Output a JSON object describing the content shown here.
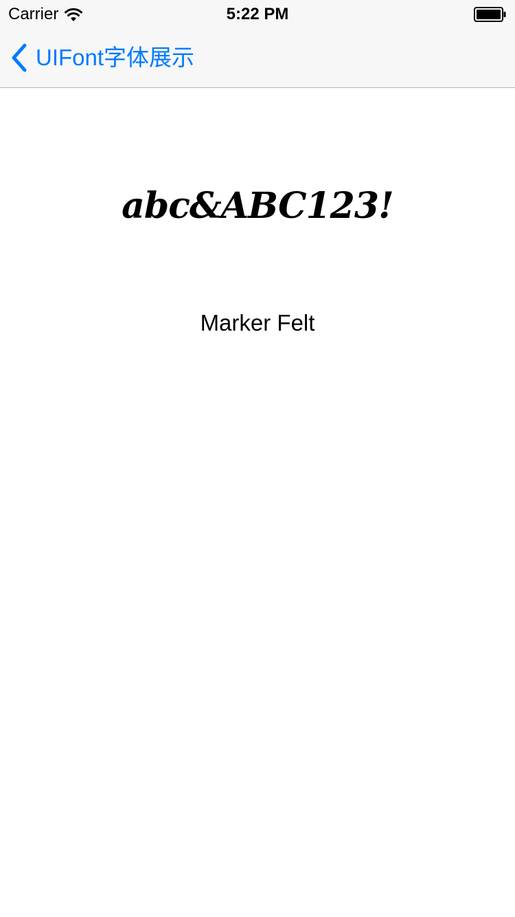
{
  "status_bar": {
    "carrier": "Carrier",
    "time": "5:22 PM",
    "wifi_icon": "wifi-icon",
    "battery_icon": "battery-full-icon"
  },
  "nav_bar": {
    "back_label": "UIFont字体展示",
    "back_icon": "chevron-left-icon",
    "tint_color": "#007aff"
  },
  "content": {
    "sample_text": "abc&ABC123!",
    "font_name": "Marker Felt"
  }
}
